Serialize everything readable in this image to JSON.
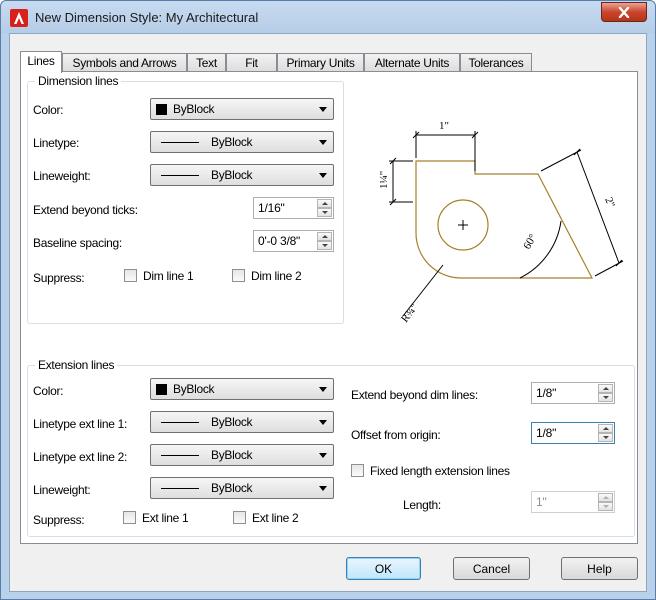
{
  "window": {
    "title": "New Dimension Style: My Architectural"
  },
  "tabs": [
    "Lines",
    "Symbols and Arrows",
    "Text",
    "Fit",
    "Primary Units",
    "Alternate Units",
    "Tolerances"
  ],
  "dimension_lines": {
    "group_title": "Dimension lines",
    "color_label": "Color:",
    "color_value": "ByBlock",
    "linetype_label": "Linetype:",
    "linetype_value": "ByBlock",
    "lineweight_label": "Lineweight:",
    "lineweight_value": "ByBlock",
    "extend_label": "Extend beyond ticks:",
    "extend_value": "1/16\"",
    "baseline_label": "Baseline spacing:",
    "baseline_value": "0'-0 3/8\"",
    "suppress_label": "Suppress:",
    "dim_line1": "Dim line 1",
    "dim_line2": "Dim line 2"
  },
  "extension_lines": {
    "group_title": "Extension lines",
    "color_label": "Color:",
    "color_value": "ByBlock",
    "linetype1_label": "Linetype ext line 1:",
    "linetype1_value": "ByBlock",
    "linetype2_label": "Linetype ext line 2:",
    "linetype2_value": "ByBlock",
    "lineweight_label": "Lineweight:",
    "lineweight_value": "ByBlock",
    "suppress_label": "Suppress:",
    "ext_line1": "Ext line 1",
    "ext_line2": "Ext line 2",
    "extend_label": "Extend beyond dim lines:",
    "extend_value": "1/8\"",
    "offset_label": "Offset from origin:",
    "offset_value": "1/8\"",
    "fixed_length_label": "Fixed length extension lines",
    "length_label": "Length:",
    "length_value": "1\""
  },
  "preview": {
    "dim_top": "1\"",
    "dim_left": "1¼\"",
    "dim_right": "2\"",
    "dim_angle": "60°",
    "dim_radius": "R¾\""
  },
  "buttons": {
    "ok": "OK",
    "cancel": "Cancel",
    "help": "Help"
  },
  "colors": {
    "preview_outline": "#a6802a",
    "accent": "#3c7fb1"
  }
}
